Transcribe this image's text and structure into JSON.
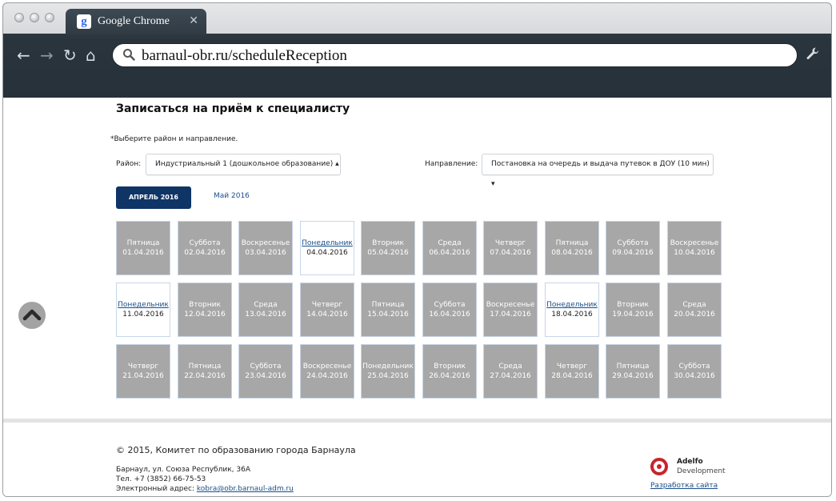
{
  "browser": {
    "tab_title": "Google Chrome",
    "tab_close": "✕",
    "favicon": "g",
    "url": "barnaul-obr.ru/scheduleReception",
    "icons": {
      "back": "back-arrow-icon",
      "forward": "forward-arrow-icon",
      "reload": "reload-icon",
      "home": "home-icon",
      "search": "search-icon",
      "wrench": "wrench-icon"
    }
  },
  "page": {
    "title": "Записаться на приём к специалисту",
    "hint": "*Выберите район и направление.",
    "district_label": "Район:",
    "district_value": "Индустриальный 1 (дошкольное образование) ▴",
    "direction_label": "Направление:",
    "direction_value": "Постановка на очередь и выдача путевок в ДОУ (10 мин) ▾",
    "months": {
      "active": "АПРЕЛЬ 2016",
      "next": "Май 2016"
    }
  },
  "calendar": [
    [
      {
        "day": "Пятница",
        "date": "01.04.2016",
        "available": false
      },
      {
        "day": "Суббота",
        "date": "02.04.2016",
        "available": false
      },
      {
        "day": "Воскресенье",
        "date": "03.04.2016",
        "available": false
      },
      {
        "day": "Понедельник",
        "date": "04.04.2016",
        "available": true
      },
      {
        "day": "Вторник",
        "date": "05.04.2016",
        "available": false
      },
      {
        "day": "Среда",
        "date": "06.04.2016",
        "available": false
      },
      {
        "day": "Четверг",
        "date": "07.04.2016",
        "available": false
      },
      {
        "day": "Пятница",
        "date": "08.04.2016",
        "available": false
      },
      {
        "day": "Суббота",
        "date": "09.04.2016",
        "available": false
      },
      {
        "day": "Воскресенье",
        "date": "10.04.2016",
        "available": false
      }
    ],
    [
      {
        "day": "Понедельник",
        "date": "11.04.2016",
        "available": true
      },
      {
        "day": "Вторник",
        "date": "12.04.2016",
        "available": false
      },
      {
        "day": "Среда",
        "date": "13.04.2016",
        "available": false
      },
      {
        "day": "Четверг",
        "date": "14.04.2016",
        "available": false
      },
      {
        "day": "Пятница",
        "date": "15.04.2016",
        "available": false
      },
      {
        "day": "Суббота",
        "date": "16.04.2016",
        "available": false
      },
      {
        "day": "Воскресенье",
        "date": "17.04.2016",
        "available": false
      },
      {
        "day": "Понедельник",
        "date": "18.04.2016",
        "available": true
      },
      {
        "day": "Вторник",
        "date": "19.04.2016",
        "available": false
      },
      {
        "day": "Среда",
        "date": "20.04.2016",
        "available": false
      }
    ],
    [
      {
        "day": "Четверг",
        "date": "21.04.2016",
        "available": false
      },
      {
        "day": "Пятница",
        "date": "22.04.2016",
        "available": false
      },
      {
        "day": "Суббота",
        "date": "23.04.2016",
        "available": false
      },
      {
        "day": "Воскресенье",
        "date": "24.04.2016",
        "available": false
      },
      {
        "day": "Понедельник",
        "date": "25.04.2016",
        "available": false
      },
      {
        "day": "Вторник",
        "date": "26.04.2016",
        "available": false
      },
      {
        "day": "Среда",
        "date": "27.04.2016",
        "available": false
      },
      {
        "day": "Четверг",
        "date": "28.04.2016",
        "available": false
      },
      {
        "day": "Пятница",
        "date": "29.04.2016",
        "available": false
      },
      {
        "day": "Суббота",
        "date": "30.04.2016",
        "available": false
      }
    ]
  ],
  "footer": {
    "copyright": "© 2015, Комитет по образованию города Барнаула",
    "address": "Барнаул, ул. Союза Республик, 36А",
    "phone": "Тел. +7 (3852) 66-75-53",
    "email_label": "Электронный адрес: ",
    "email": "kobra@obr.barnaul-adm.ru",
    "logo_name": "Adelfo",
    "logo_sub": "Development",
    "dev_link": "Разработка сайта"
  },
  "colors": {
    "active_month": "#0f3466",
    "busy_day": "#a7a7a7",
    "link": "#1a4e8a",
    "logo_red": "#c9232c"
  }
}
